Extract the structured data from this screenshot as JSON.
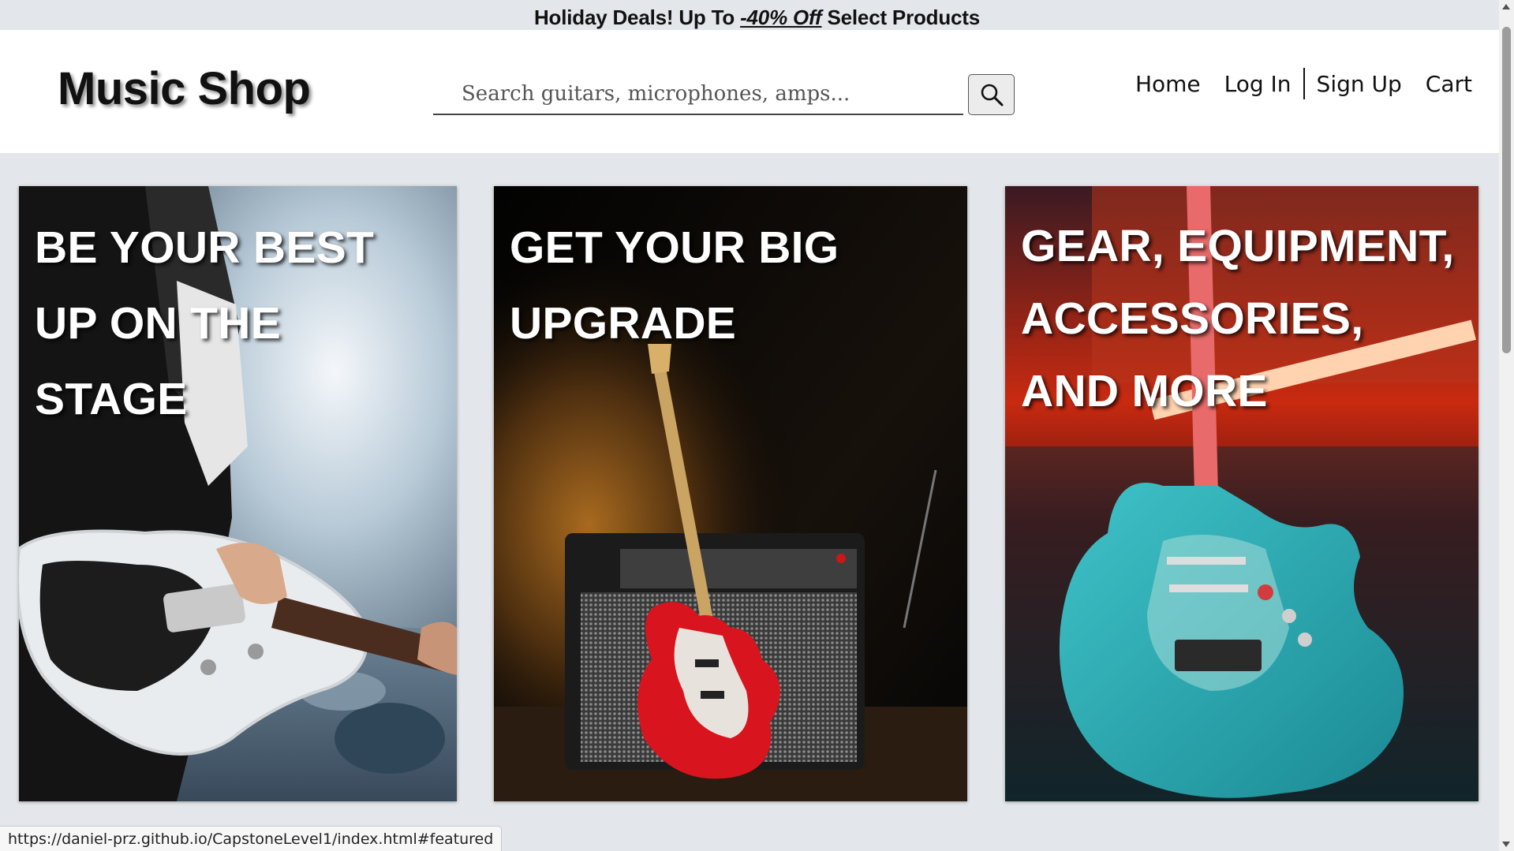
{
  "promo": {
    "before": "Holiday Deals! Up To ",
    "deal": "-40% Off",
    "after": " Select Products"
  },
  "header": {
    "logo": "Music Shop",
    "search": {
      "placeholder": "Search guitars, microphones, amps...",
      "value": "",
      "icon": "search-icon"
    },
    "nav": [
      "Home",
      "Log In",
      "Sign Up",
      "Cart"
    ]
  },
  "cards": [
    {
      "title": "Be your best up on the stage",
      "image": "guitarist-on-stage-photo"
    },
    {
      "title": "Get your big upgrade",
      "image": "red-guitar-and-amp-photo"
    },
    {
      "title": "Gear, equipment, accessories, and more",
      "image": "teal-guitar-neon-photo"
    }
  ],
  "status_url": "https://daniel-prz.github.io/CapstoneLevel1/index.html#featured",
  "colors": {
    "page_bg": "#e3e6ea",
    "header_bg": "#ffffff",
    "text": "#111111",
    "card_text": "#ffffff"
  }
}
